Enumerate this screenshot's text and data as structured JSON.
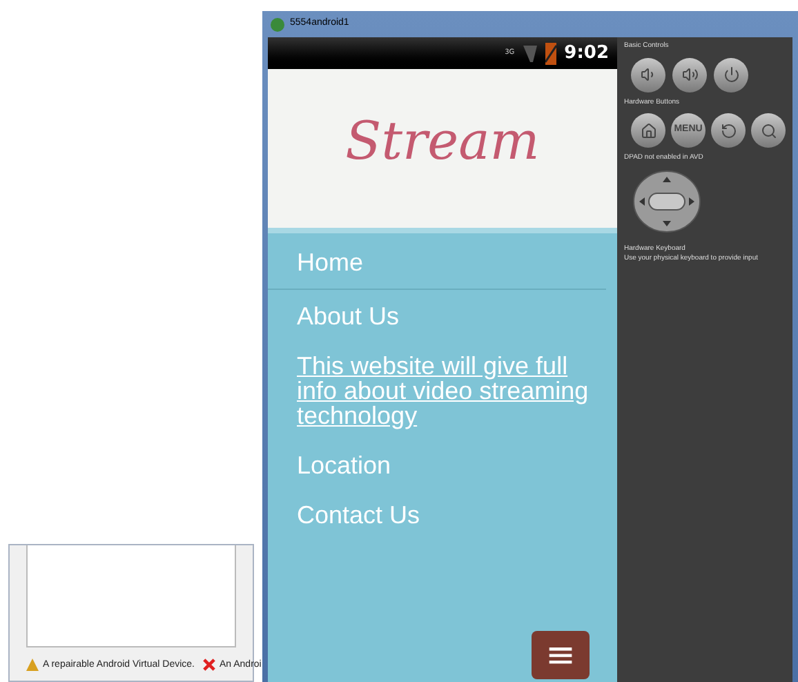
{
  "background_window": {
    "status": [
      {
        "kind": "warning",
        "text": "A repairable Android Virtual Device."
      },
      {
        "kind": "error",
        "text": "An Androi"
      }
    ]
  },
  "window": {
    "title": "5554android1"
  },
  "status_bar": {
    "network": "3G",
    "time": "9:02"
  },
  "site": {
    "logo": "Stream",
    "menu": [
      {
        "label": "Home",
        "link": false
      },
      {
        "label": "About Us",
        "link": false
      },
      {
        "label": "This website will give full info about video streaming technology",
        "link": true
      },
      {
        "label": "Location",
        "link": false
      },
      {
        "label": "Contact Us",
        "link": false
      }
    ],
    "menu_button": "≡"
  },
  "controls": {
    "basic_controls": "Basic Controls",
    "hardware_buttons": "Hardware Buttons",
    "menu_key": "MENU",
    "dpad_note": "DPAD not enabled in AVD",
    "keyboard_title": "Hardware Keyboard",
    "keyboard_note": "Use your physical keyboard to provide input"
  }
}
